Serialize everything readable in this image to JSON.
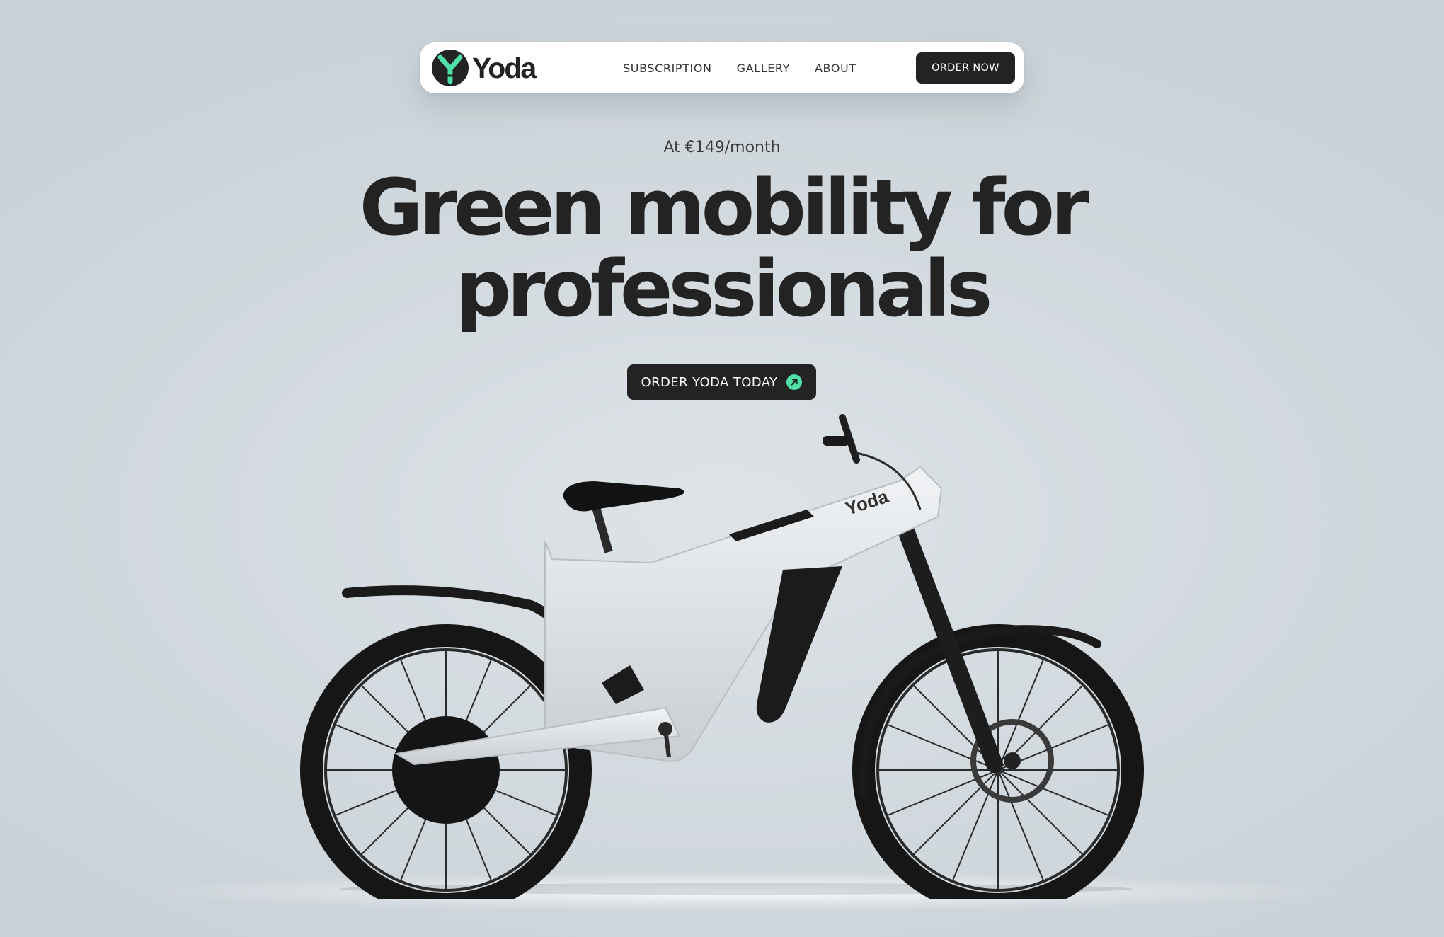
{
  "brand": {
    "name": "Yoda",
    "accent": "#4fe0a6",
    "dark": "#232323"
  },
  "nav": {
    "links": [
      "SUBSCRIPTION",
      "GALLERY",
      "ABOUT"
    ],
    "cta_label": "ORDER NOW"
  },
  "hero": {
    "price": "At €149/month",
    "headline_line1": "Green mobility for",
    "headline_line2": "professionals",
    "cta_label": "ORDER YODA TODAY",
    "cta_icon": "arrow-up-right-icon"
  },
  "product": {
    "frame_text": "Yoda"
  }
}
